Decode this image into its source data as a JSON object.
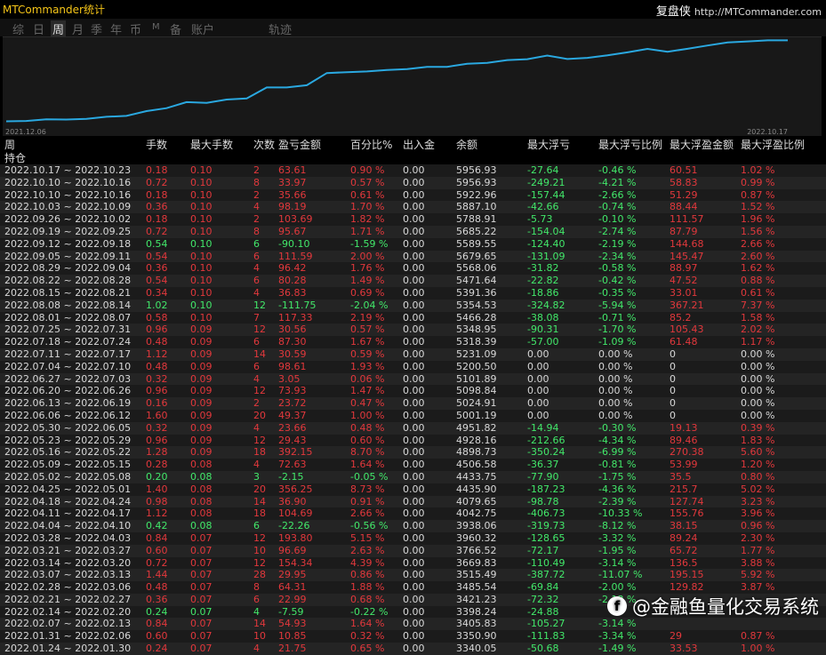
{
  "app_title": "MTCommander统计",
  "brand": {
    "name": "复盘侠",
    "url": "http://MTCommander.com"
  },
  "tabs": [
    "综",
    "日",
    "周",
    "月",
    "季",
    "年",
    "币",
    "M",
    "备",
    "账户",
    "轨迹"
  ],
  "active_tab": "周",
  "chart": {
    "start_label": "2021.12.06",
    "end_label": "2022.10.17",
    "line_color": "#2aa8e0"
  },
  "columns": [
    "周",
    "手数",
    "最大手数",
    "次数",
    "盈亏金额",
    "百分比%",
    "出入金",
    "余额",
    "最大浮亏",
    "最大浮亏比例",
    "最大浮盈金额",
    "最大浮盈比例"
  ],
  "holding_label": "持仓",
  "rows": [
    {
      "week": "2022.10.17 ~ 2022.10.23",
      "lots": "0.18",
      "max_lots": "0.10",
      "count": "2",
      "pl": "63.61",
      "pct": "0.90 %",
      "io": "0.00",
      "balance": "5956.93",
      "max_dd": "-27.64",
      "max_dd_pct": "-0.46 %",
      "max_fp": "60.51",
      "max_fp_pct": "1.02 %",
      "color": "r"
    },
    {
      "week": "2022.10.10 ~ 2022.10.16",
      "lots": "0.72",
      "max_lots": "0.10",
      "count": "8",
      "pl": "33.97",
      "pct": "0.57 %",
      "io": "0.00",
      "balance": "5956.93",
      "max_dd": "-249.21",
      "max_dd_pct": "-4.21 %",
      "max_fp": "58.83",
      "max_fp_pct": "0.99 %",
      "color": "r"
    },
    {
      "week": "2022.10.10 ~ 2022.10.16",
      "lots": "0.18",
      "max_lots": "0.10",
      "count": "2",
      "pl": "35.66",
      "pct": "0.61 %",
      "io": "0.00",
      "balance": "5922.96",
      "max_dd": "-157.44",
      "max_dd_pct": "-2.66 %",
      "max_fp": "51.29",
      "max_fp_pct": "0.87 %",
      "color": "r"
    },
    {
      "week": "2022.10.03 ~ 2022.10.09",
      "lots": "0.36",
      "max_lots": "0.10",
      "count": "4",
      "pl": "98.19",
      "pct": "1.70 %",
      "io": "0.00",
      "balance": "5887.10",
      "max_dd": "-42.66",
      "max_dd_pct": "-0.74 %",
      "max_fp": "88.44",
      "max_fp_pct": "1.52 %",
      "color": "r"
    },
    {
      "week": "2022.09.26 ~ 2022.10.02",
      "lots": "0.18",
      "max_lots": "0.10",
      "count": "2",
      "pl": "103.69",
      "pct": "1.82 %",
      "io": "0.00",
      "balance": "5788.91",
      "max_dd": "-5.73",
      "max_dd_pct": "-0.10 %",
      "max_fp": "111.57",
      "max_fp_pct": "1.96 %",
      "color": "r"
    },
    {
      "week": "2022.09.19 ~ 2022.09.25",
      "lots": "0.72",
      "max_lots": "0.10",
      "count": "8",
      "pl": "95.67",
      "pct": "1.71 %",
      "io": "0.00",
      "balance": "5685.22",
      "max_dd": "-154.04",
      "max_dd_pct": "-2.74 %",
      "max_fp": "87.79",
      "max_fp_pct": "1.56 %",
      "color": "r"
    },
    {
      "week": "2022.09.12 ~ 2022.09.18",
      "lots": "0.54",
      "max_lots": "0.10",
      "count": "6",
      "pl": "-90.10",
      "pct": "-1.59 %",
      "io": "0.00",
      "balance": "5589.55",
      "max_dd": "-124.40",
      "max_dd_pct": "-2.19 %",
      "max_fp": "144.68",
      "max_fp_pct": "2.66 %",
      "color": "g"
    },
    {
      "week": "2022.09.05 ~ 2022.09.11",
      "lots": "0.54",
      "max_lots": "0.10",
      "count": "6",
      "pl": "111.59",
      "pct": "2.00 %",
      "io": "0.00",
      "balance": "5679.65",
      "max_dd": "-131.09",
      "max_dd_pct": "-2.34 %",
      "max_fp": "145.47",
      "max_fp_pct": "2.60 %",
      "color": "r"
    },
    {
      "week": "2022.08.29 ~ 2022.09.04",
      "lots": "0.36",
      "max_lots": "0.10",
      "count": "4",
      "pl": "96.42",
      "pct": "1.76 %",
      "io": "0.00",
      "balance": "5568.06",
      "max_dd": "-31.82",
      "max_dd_pct": "-0.58 %",
      "max_fp": "88.97",
      "max_fp_pct": "1.62 %",
      "color": "r"
    },
    {
      "week": "2022.08.22 ~ 2022.08.28",
      "lots": "0.54",
      "max_lots": "0.10",
      "count": "6",
      "pl": "80.28",
      "pct": "1.49 %",
      "io": "0.00",
      "balance": "5471.64",
      "max_dd": "-22.82",
      "max_dd_pct": "-0.42 %",
      "max_fp": "47.52",
      "max_fp_pct": "0.88 %",
      "color": "r"
    },
    {
      "week": "2022.08.15 ~ 2022.08.21",
      "lots": "0.34",
      "max_lots": "0.10",
      "count": "4",
      "pl": "36.83",
      "pct": "0.69 %",
      "io": "0.00",
      "balance": "5391.36",
      "max_dd": "-18.86",
      "max_dd_pct": "-0.35 %",
      "max_fp": "33.01",
      "max_fp_pct": "0.61 %",
      "color": "r"
    },
    {
      "week": "2022.08.08 ~ 2022.08.14",
      "lots": "1.02",
      "max_lots": "0.10",
      "count": "12",
      "pl": "-111.75",
      "pct": "-2.04 %",
      "io": "0.00",
      "balance": "5354.53",
      "max_dd": "-324.82",
      "max_dd_pct": "-5.94 %",
      "max_fp": "367.21",
      "max_fp_pct": "7.37 %",
      "color": "g"
    },
    {
      "week": "2022.08.01 ~ 2022.08.07",
      "lots": "0.58",
      "max_lots": "0.10",
      "count": "7",
      "pl": "117.33",
      "pct": "2.19 %",
      "io": "0.00",
      "balance": "5466.28",
      "max_dd": "-38.08",
      "max_dd_pct": "-0.71 %",
      "max_fp": "85.2",
      "max_fp_pct": "1.58 %",
      "color": "r"
    },
    {
      "week": "2022.07.25 ~ 2022.07.31",
      "lots": "0.96",
      "max_lots": "0.09",
      "count": "12",
      "pl": "30.56",
      "pct": "0.57 %",
      "io": "0.00",
      "balance": "5348.95",
      "max_dd": "-90.31",
      "max_dd_pct": "-1.70 %",
      "max_fp": "105.43",
      "max_fp_pct": "2.02 %",
      "color": "r"
    },
    {
      "week": "2022.07.18 ~ 2022.07.24",
      "lots": "0.48",
      "max_lots": "0.09",
      "count": "6",
      "pl": "87.30",
      "pct": "1.67 %",
      "io": "0.00",
      "balance": "5318.39",
      "max_dd": "-57.00",
      "max_dd_pct": "-1.09 %",
      "max_fp": "61.48",
      "max_fp_pct": "1.17 %",
      "color": "r"
    },
    {
      "week": "2022.07.11 ~ 2022.07.17",
      "lots": "1.12",
      "max_lots": "0.09",
      "count": "14",
      "pl": "30.59",
      "pct": "0.59 %",
      "io": "0.00",
      "balance": "5231.09",
      "max_dd": "0.00",
      "max_dd_pct": "0.00 %",
      "max_fp": "0",
      "max_fp_pct": "0.00 %",
      "color": "r"
    },
    {
      "week": "2022.07.04 ~ 2022.07.10",
      "lots": "0.48",
      "max_lots": "0.09",
      "count": "6",
      "pl": "98.61",
      "pct": "1.93 %",
      "io": "0.00",
      "balance": "5200.50",
      "max_dd": "0.00",
      "max_dd_pct": "0.00 %",
      "max_fp": "0",
      "max_fp_pct": "0.00 %",
      "color": "r"
    },
    {
      "week": "2022.06.27 ~ 2022.07.03",
      "lots": "0.32",
      "max_lots": "0.09",
      "count": "4",
      "pl": "3.05",
      "pct": "0.06 %",
      "io": "0.00",
      "balance": "5101.89",
      "max_dd": "0.00",
      "max_dd_pct": "0.00 %",
      "max_fp": "0",
      "max_fp_pct": "0.00 %",
      "color": "r"
    },
    {
      "week": "2022.06.20 ~ 2022.06.26",
      "lots": "0.96",
      "max_lots": "0.09",
      "count": "12",
      "pl": "73.93",
      "pct": "1.47 %",
      "io": "0.00",
      "balance": "5098.84",
      "max_dd": "0.00",
      "max_dd_pct": "0.00 %",
      "max_fp": "0",
      "max_fp_pct": "0.00 %",
      "color": "r"
    },
    {
      "week": "2022.06.13 ~ 2022.06.19",
      "lots": "0.16",
      "max_lots": "0.09",
      "count": "2",
      "pl": "23.72",
      "pct": "0.47 %",
      "io": "0.00",
      "balance": "5024.91",
      "max_dd": "0.00",
      "max_dd_pct": "0.00 %",
      "max_fp": "0",
      "max_fp_pct": "0.00 %",
      "color": "r"
    },
    {
      "week": "2022.06.06 ~ 2022.06.12",
      "lots": "1.60",
      "max_lots": "0.09",
      "count": "20",
      "pl": "49.37",
      "pct": "1.00 %",
      "io": "0.00",
      "balance": "5001.19",
      "max_dd": "0.00",
      "max_dd_pct": "0.00 %",
      "max_fp": "0",
      "max_fp_pct": "0.00 %",
      "color": "r"
    },
    {
      "week": "2022.05.30 ~ 2022.06.05",
      "lots": "0.32",
      "max_lots": "0.09",
      "count": "4",
      "pl": "23.66",
      "pct": "0.48 %",
      "io": "0.00",
      "balance": "4951.82",
      "max_dd": "-14.94",
      "max_dd_pct": "-0.30 %",
      "max_fp": "19.13",
      "max_fp_pct": "0.39 %",
      "color": "r"
    },
    {
      "week": "2022.05.23 ~ 2022.05.29",
      "lots": "0.96",
      "max_lots": "0.09",
      "count": "12",
      "pl": "29.43",
      "pct": "0.60 %",
      "io": "0.00",
      "balance": "4928.16",
      "max_dd": "-212.66",
      "max_dd_pct": "-4.34 %",
      "max_fp": "89.46",
      "max_fp_pct": "1.83 %",
      "color": "r"
    },
    {
      "week": "2022.05.16 ~ 2022.05.22",
      "lots": "1.28",
      "max_lots": "0.09",
      "count": "18",
      "pl": "392.15",
      "pct": "8.70 %",
      "io": "0.00",
      "balance": "4898.73",
      "max_dd": "-350.24",
      "max_dd_pct": "-6.99 %",
      "max_fp": "270.38",
      "max_fp_pct": "5.60 %",
      "color": "r"
    },
    {
      "week": "2022.05.09 ~ 2022.05.15",
      "lots": "0.28",
      "max_lots": "0.08",
      "count": "4",
      "pl": "72.63",
      "pct": "1.64 %",
      "io": "0.00",
      "balance": "4506.58",
      "max_dd": "-36.37",
      "max_dd_pct": "-0.81 %",
      "max_fp": "53.99",
      "max_fp_pct": "1.20 %",
      "color": "r"
    },
    {
      "week": "2022.05.02 ~ 2022.05.08",
      "lots": "0.20",
      "max_lots": "0.08",
      "count": "3",
      "pl": "-2.15",
      "pct": "-0.05 %",
      "io": "0.00",
      "balance": "4433.75",
      "max_dd": "-77.90",
      "max_dd_pct": "-1.75 %",
      "max_fp": "35.5",
      "max_fp_pct": "0.80 %",
      "color": "g"
    },
    {
      "week": "2022.04.25 ~ 2022.05.01",
      "lots": "1.40",
      "max_lots": "0.08",
      "count": "20",
      "pl": "356.25",
      "pct": "8.73 %",
      "io": "0.00",
      "balance": "4435.90",
      "max_dd": "-187.23",
      "max_dd_pct": "-4.36 %",
      "max_fp": "215.7",
      "max_fp_pct": "5.02 %",
      "color": "r"
    },
    {
      "week": "2022.04.18 ~ 2022.04.24",
      "lots": "0.98",
      "max_lots": "0.08",
      "count": "14",
      "pl": "36.90",
      "pct": "0.91 %",
      "io": "0.00",
      "balance": "4079.65",
      "max_dd": "-98.78",
      "max_dd_pct": "-2.39 %",
      "max_fp": "127.74",
      "max_fp_pct": "3.23 %",
      "color": "r"
    },
    {
      "week": "2022.04.11 ~ 2022.04.17",
      "lots": "1.12",
      "max_lots": "0.08",
      "count": "18",
      "pl": "104.69",
      "pct": "2.66 %",
      "io": "0.00",
      "balance": "4042.75",
      "max_dd": "-406.73",
      "max_dd_pct": "-10.33 %",
      "max_fp": "155.76",
      "max_fp_pct": "3.96 %",
      "color": "r"
    },
    {
      "week": "2022.04.04 ~ 2022.04.10",
      "lots": "0.42",
      "max_lots": "0.08",
      "count": "6",
      "pl": "-22.26",
      "pct": "-0.56 %",
      "io": "0.00",
      "balance": "3938.06",
      "max_dd": "-319.73",
      "max_dd_pct": "-8.12 %",
      "max_fp": "38.15",
      "max_fp_pct": "0.96 %",
      "color": "g"
    },
    {
      "week": "2022.03.28 ~ 2022.04.03",
      "lots": "0.84",
      "max_lots": "0.07",
      "count": "12",
      "pl": "193.80",
      "pct": "5.15 %",
      "io": "0.00",
      "balance": "3960.32",
      "max_dd": "-128.65",
      "max_dd_pct": "-3.32 %",
      "max_fp": "89.24",
      "max_fp_pct": "2.30 %",
      "color": "r"
    },
    {
      "week": "2022.03.21 ~ 2022.03.27",
      "lots": "0.60",
      "max_lots": "0.07",
      "count": "10",
      "pl": "96.69",
      "pct": "2.63 %",
      "io": "0.00",
      "balance": "3766.52",
      "max_dd": "-72.17",
      "max_dd_pct": "-1.95 %",
      "max_fp": "65.72",
      "max_fp_pct": "1.77 %",
      "color": "r"
    },
    {
      "week": "2022.03.14 ~ 2022.03.20",
      "lots": "0.72",
      "max_lots": "0.07",
      "count": "12",
      "pl": "154.34",
      "pct": "4.39 %",
      "io": "0.00",
      "balance": "3669.83",
      "max_dd": "-110.49",
      "max_dd_pct": "-3.14 %",
      "max_fp": "136.5",
      "max_fp_pct": "3.88 %",
      "color": "r"
    },
    {
      "week": "2022.03.07 ~ 2022.03.13",
      "lots": "1.44",
      "max_lots": "0.07",
      "count": "28",
      "pl": "29.95",
      "pct": "0.86 %",
      "io": "0.00",
      "balance": "3515.49",
      "max_dd": "-387.72",
      "max_dd_pct": "-11.07 %",
      "max_fp": "195.15",
      "max_fp_pct": "5.92 %",
      "color": "r"
    },
    {
      "week": "2022.02.28 ~ 2022.03.06",
      "lots": "0.48",
      "max_lots": "0.07",
      "count": "8",
      "pl": "64.31",
      "pct": "1.88 %",
      "io": "0.00",
      "balance": "3485.54",
      "max_dd": "-69.84",
      "max_dd_pct": "-2.00 %",
      "max_fp": "129.82",
      "max_fp_pct": "3.87 %",
      "color": "r"
    },
    {
      "week": "2022.02.21 ~ 2022.02.27",
      "lots": "0.36",
      "max_lots": "0.07",
      "count": "6",
      "pl": "22.99",
      "pct": "0.68 %",
      "io": "0.00",
      "balance": "3421.23",
      "max_dd": "-72.32",
      "max_dd_pct": "-2.13 %",
      "max_fp": "",
      "max_fp_pct": "",
      "color": "r"
    },
    {
      "week": "2022.02.14 ~ 2022.02.20",
      "lots": "0.24",
      "max_lots": "0.07",
      "count": "4",
      "pl": "-7.59",
      "pct": "-0.22 %",
      "io": "0.00",
      "balance": "3398.24",
      "max_dd": "-24.88",
      "max_dd_pct": "",
      "max_fp": "",
      "max_fp_pct": "",
      "color": "g"
    },
    {
      "week": "2022.02.07 ~ 2022.02.13",
      "lots": "0.84",
      "max_lots": "0.07",
      "count": "14",
      "pl": "54.93",
      "pct": "1.64 %",
      "io": "0.00",
      "balance": "3405.83",
      "max_dd": "-105.27",
      "max_dd_pct": "-3.14 %",
      "max_fp": "",
      "max_fp_pct": "",
      "color": "r"
    },
    {
      "week": "2022.01.31 ~ 2022.02.06",
      "lots": "0.60",
      "max_lots": "0.07",
      "count": "10",
      "pl": "10.85",
      "pct": "0.32 %",
      "io": "0.00",
      "balance": "3350.90",
      "max_dd": "-111.83",
      "max_dd_pct": "-3.34 %",
      "max_fp": "29",
      "max_fp_pct": "0.87 %",
      "color": "r"
    },
    {
      "week": "2022.01.24 ~ 2022.01.30",
      "lots": "0.24",
      "max_lots": "0.07",
      "count": "4",
      "pl": "21.75",
      "pct": "0.65 %",
      "io": "0.00",
      "balance": "3340.05",
      "max_dd": "-50.68",
      "max_dd_pct": "-1.49 %",
      "max_fp": "33.53",
      "max_fp_pct": "1.00 %",
      "color": "r"
    }
  ],
  "watermark": "@金融鱼量化交易系统"
}
